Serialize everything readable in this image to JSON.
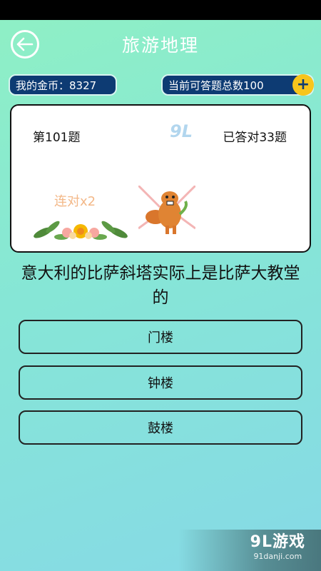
{
  "header": {
    "title": "旅游地理",
    "back_icon": "arrow-left-icon"
  },
  "stats": {
    "coins_label": "我的金币：8327",
    "total_label": "当前可答题总数100",
    "plus_label": "+"
  },
  "card": {
    "question_number": "第101题",
    "answered": "已答对33题",
    "streak": "连对x2",
    "watermark": "9L游戏"
  },
  "question": {
    "text": "意大利的比萨斜塔实际上是比萨大教堂的"
  },
  "options": [
    {
      "label": "门楼"
    },
    {
      "label": "钟楼"
    },
    {
      "label": "鼓楼"
    }
  ],
  "brand": {
    "name": "9L游戏",
    "url": "91danji.com"
  },
  "colors": {
    "accent_navy": "#0d3b73",
    "gold": "#f7c51c",
    "bg_green": "#8ff0c4",
    "bg_blue": "#86d9e6"
  }
}
